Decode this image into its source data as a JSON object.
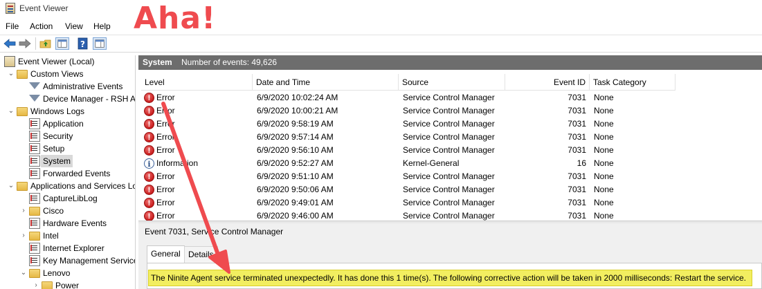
{
  "window": {
    "title": "Event Viewer"
  },
  "menu": {
    "file": "File",
    "action": "Action",
    "view": "View",
    "help": "Help"
  },
  "annotation": {
    "text": "Aha!",
    "color": "#ef4b4f"
  },
  "toolbar": {
    "icons": [
      "back-arrow-icon",
      "forward-arrow-icon",
      "folder-up-icon",
      "show-hide-console-tree-icon",
      "help-icon",
      "action-pane-icon"
    ]
  },
  "tree": {
    "items": [
      {
        "label": "Event Viewer (Local)",
        "icon": "event-viewer-icon",
        "chevron": "",
        "indent": 0
      },
      {
        "label": "Custom Views",
        "icon": "folder-icon",
        "chevron": "⌄",
        "indent": 1
      },
      {
        "label": "Administrative Events",
        "icon": "filter-icon",
        "chevron": "",
        "indent": 2
      },
      {
        "label": "Device Manager - RSH A:",
        "icon": "filter-icon",
        "chevron": "",
        "indent": 2
      },
      {
        "label": "Windows Logs",
        "icon": "folder-icon",
        "chevron": "⌄",
        "indent": 1
      },
      {
        "label": "Application",
        "icon": "log-icon",
        "chevron": "",
        "indent": 2
      },
      {
        "label": "Security",
        "icon": "log-icon",
        "chevron": "",
        "indent": 2
      },
      {
        "label": "Setup",
        "icon": "log-icon",
        "chevron": "",
        "indent": 2
      },
      {
        "label": "System",
        "icon": "log-icon",
        "chevron": "",
        "indent": 2,
        "selected": true
      },
      {
        "label": "Forwarded Events",
        "icon": "log-icon",
        "chevron": "",
        "indent": 2
      },
      {
        "label": "Applications and Services Lo",
        "icon": "folder-icon",
        "chevron": "⌄",
        "indent": 1
      },
      {
        "label": "CaptureLibLog",
        "icon": "log-icon",
        "chevron": "",
        "indent": 2
      },
      {
        "label": "Cisco",
        "icon": "folder-icon",
        "chevron": "›",
        "indent": 2
      },
      {
        "label": "Hardware Events",
        "icon": "log-icon",
        "chevron": "",
        "indent": 2
      },
      {
        "label": "Intel",
        "icon": "folder-icon",
        "chevron": "›",
        "indent": 2
      },
      {
        "label": "Internet Explorer",
        "icon": "log-icon",
        "chevron": "",
        "indent": 2
      },
      {
        "label": "Key Management Service",
        "icon": "log-icon",
        "chevron": "",
        "indent": 2
      },
      {
        "label": "Lenovo",
        "icon": "folder-icon",
        "chevron": "⌄",
        "indent": 2
      },
      {
        "label": "Power",
        "icon": "folder-icon",
        "chevron": "›",
        "indent": 3
      }
    ]
  },
  "log_header": {
    "name": "System",
    "count_text": "Number of events: 49,626"
  },
  "table": {
    "columns": [
      "Level",
      "Date and Time",
      "Source",
      "Event ID",
      "Task Category"
    ],
    "rows": [
      {
        "level": "Error",
        "type": "error",
        "datetime": "6/9/2020 10:02:24 AM",
        "source": "Service Control Manager",
        "event_id": "7031",
        "category": "None"
      },
      {
        "level": "Error",
        "type": "error",
        "datetime": "6/9/2020 10:00:21 AM",
        "source": "Service Control Manager",
        "event_id": "7031",
        "category": "None"
      },
      {
        "level": "Error",
        "type": "error",
        "datetime": "6/9/2020 9:58:19 AM",
        "source": "Service Control Manager",
        "event_id": "7031",
        "category": "None"
      },
      {
        "level": "Error",
        "type": "error",
        "datetime": "6/9/2020 9:57:14 AM",
        "source": "Service Control Manager",
        "event_id": "7031",
        "category": "None"
      },
      {
        "level": "Error",
        "type": "error",
        "datetime": "6/9/2020 9:56:10 AM",
        "source": "Service Control Manager",
        "event_id": "7031",
        "category": "None"
      },
      {
        "level": "Information",
        "type": "info",
        "datetime": "6/9/2020 9:52:27 AM",
        "source": "Kernel-General",
        "event_id": "16",
        "category": "None"
      },
      {
        "level": "Error",
        "type": "error",
        "datetime": "6/9/2020 9:51:10 AM",
        "source": "Service Control Manager",
        "event_id": "7031",
        "category": "None"
      },
      {
        "level": "Error",
        "type": "error",
        "datetime": "6/9/2020 9:50:06 AM",
        "source": "Service Control Manager",
        "event_id": "7031",
        "category": "None"
      },
      {
        "level": "Error",
        "type": "error",
        "datetime": "6/9/2020 9:49:01 AM",
        "source": "Service Control Manager",
        "event_id": "7031",
        "category": "None"
      },
      {
        "level": "Error",
        "type": "error",
        "datetime": "6/9/2020 9:46:00 AM",
        "source": "Service Control Manager",
        "event_id": "7031",
        "category": "None"
      }
    ]
  },
  "details": {
    "title": "Event 7031, Service Control Manager",
    "tabs": [
      "General",
      "Details"
    ],
    "message": "The Ninite Agent service terminated unexpectedly.  It has done this 1 time(s).  The following corrective action will be taken in 2000 milliseconds: Restart the service.",
    "highlight_color": "#f2ee60"
  }
}
